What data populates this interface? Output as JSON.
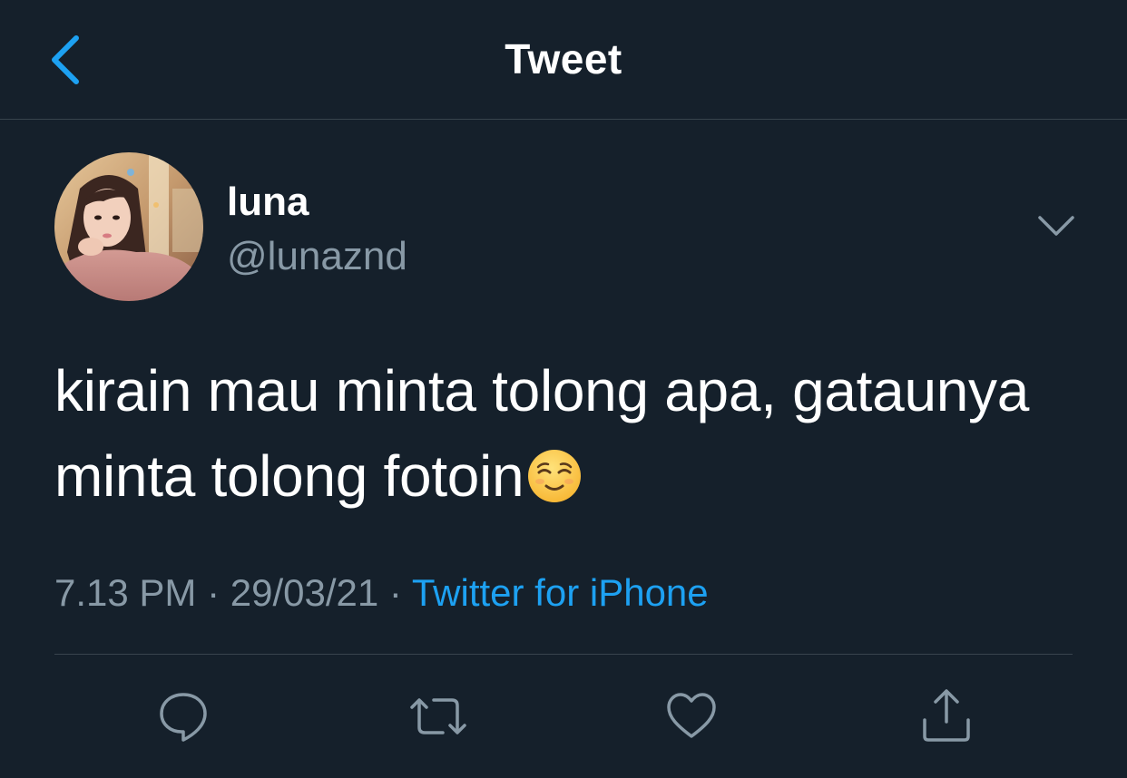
{
  "header": {
    "title": "Tweet",
    "back_icon": "chevron-left-icon"
  },
  "colors": {
    "background": "#15202b",
    "accent": "#1da1f2",
    "muted_text": "#8899a6",
    "divider": "#38444d"
  },
  "tweet": {
    "author": {
      "display_name": "luna",
      "handle": "@lunaznd",
      "avatar_icon": "profile-photo"
    },
    "options_icon": "chevron-down-icon",
    "text": "kirain mau minta tolong apa, gataunya minta tolong fotoin",
    "emoji": "relieved-face-emoji",
    "time": "7.13 PM",
    "separator": " · ",
    "date": "29/03/21",
    "source": "Twitter for iPhone"
  },
  "actions": [
    {
      "name": "reply",
      "icon": "reply-icon"
    },
    {
      "name": "retweet",
      "icon": "retweet-icon"
    },
    {
      "name": "like",
      "icon": "heart-icon"
    },
    {
      "name": "share",
      "icon": "share-icon"
    }
  ]
}
